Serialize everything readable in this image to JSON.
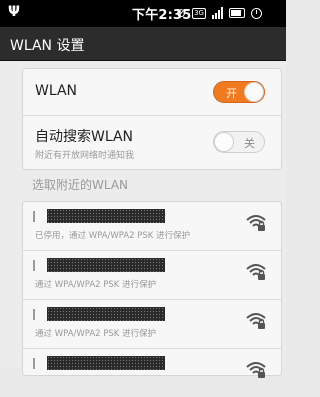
{
  "status_bar": {
    "time": "下午2:35",
    "network_type": "3G",
    "icons": [
      "usb-icon",
      "alarm-off-icon",
      "3g-icon",
      "signal-icon",
      "battery-icon",
      "clock-icon"
    ]
  },
  "title_bar": {
    "title": "WLAN 设置"
  },
  "settings": {
    "wlan": {
      "label": "WLAN",
      "toggle_text": "开",
      "state": "on"
    },
    "auto_search": {
      "label": "自动搜索WLAN",
      "sublabel": "附近有开放网络时通知我",
      "toggle_text": "关",
      "state": "off"
    }
  },
  "section_header": "选取附近的WLAN",
  "networks": [
    {
      "description": "已停用，通过 WPA/WPA2 PSK 进行保护",
      "secured": true
    },
    {
      "description": "通过 WPA/WPA2 PSK 进行保护",
      "secured": true
    },
    {
      "description": "通过 WPA/WPA2 PSK 进行保护",
      "secured": true
    },
    {
      "description": "",
      "secured": true
    }
  ],
  "colors": {
    "accent": "#f07a20",
    "status_bar": "#000000",
    "title_bar": "#2c2c2c",
    "background": "#ececec"
  }
}
